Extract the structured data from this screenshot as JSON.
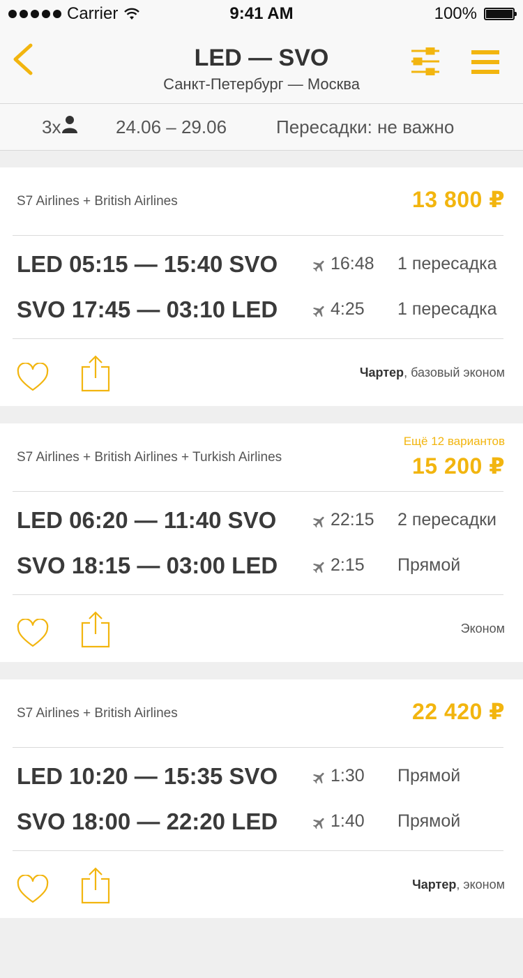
{
  "status_bar": {
    "carrier": "Carrier",
    "time": "9:41 AM",
    "battery": "100%"
  },
  "nav": {
    "title": "LED — SVO",
    "subtitle": "Санкт-Петербург — Москва"
  },
  "search": {
    "passengers": "3x",
    "dates": "24.06 – 29.06",
    "transfers": "Пересадки: не важно"
  },
  "colors": {
    "accent": "#f2b50f",
    "background": "#efefef",
    "card": "#ffffff"
  },
  "results": [
    {
      "airlines": "S7 Airlines + British Airlines",
      "more_options": "",
      "price": "13 800 ₽",
      "legs": [
        {
          "route": "LED 05:15 — 15:40 SVO",
          "duration": "16:48",
          "stops": "1 пересадка"
        },
        {
          "route": "SVO 17:45 — 03:10 LED",
          "duration": "4:25",
          "stops": "1 пересадка"
        }
      ],
      "fare_bold": "Чартер",
      "fare_rest": ", базовый эконом"
    },
    {
      "airlines": "S7 Airlines + British Airlines + Turkish Airlines",
      "more_options": "Ещё 12 вариантов",
      "price": "15 200 ₽",
      "legs": [
        {
          "route": "LED 06:20 — 11:40 SVO",
          "duration": "22:15",
          "stops": "2 пересадки"
        },
        {
          "route": "SVO 18:15 — 03:00 LED",
          "duration": "2:15",
          "stops": "Прямой"
        }
      ],
      "fare_bold": "",
      "fare_rest": "Эконом"
    },
    {
      "airlines": "S7 Airlines + British Airlines",
      "more_options": "",
      "price": "22 420 ₽",
      "legs": [
        {
          "route": "LED 10:20 — 15:35 SVO",
          "duration": "1:30",
          "stops": "Прямой"
        },
        {
          "route": "SVO 18:00 — 22:20 LED",
          "duration": "1:40",
          "stops": "Прямой"
        }
      ],
      "fare_bold": "Чартер",
      "fare_rest": ", эконом"
    }
  ]
}
